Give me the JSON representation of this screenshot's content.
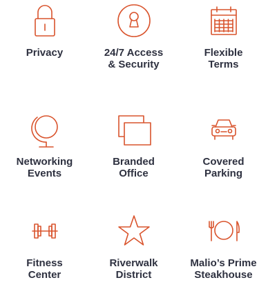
{
  "colors": {
    "icon_stroke": "#d9532c",
    "label_text": "#2e3140",
    "background": "#ffffff"
  },
  "amenities": [
    {
      "icon": "lock-icon",
      "label": "Privacy"
    },
    {
      "icon": "keyhole-icon",
      "label": "24/7 Access\n& Security"
    },
    {
      "icon": "calendar-icon",
      "label": "Flexible\nTerms"
    },
    {
      "icon": "globe-icon",
      "label": "Networking\nEvents"
    },
    {
      "icon": "office-icon",
      "label": "Branded\nOffice"
    },
    {
      "icon": "car-icon",
      "label": "Covered\nParking"
    },
    {
      "icon": "dumbbell-icon",
      "label": "Fitness\nCenter"
    },
    {
      "icon": "star-icon",
      "label": "Riverwalk\nDistrict"
    },
    {
      "icon": "dining-icon",
      "label": "Malio’s Prime\nSteakhouse"
    }
  ]
}
